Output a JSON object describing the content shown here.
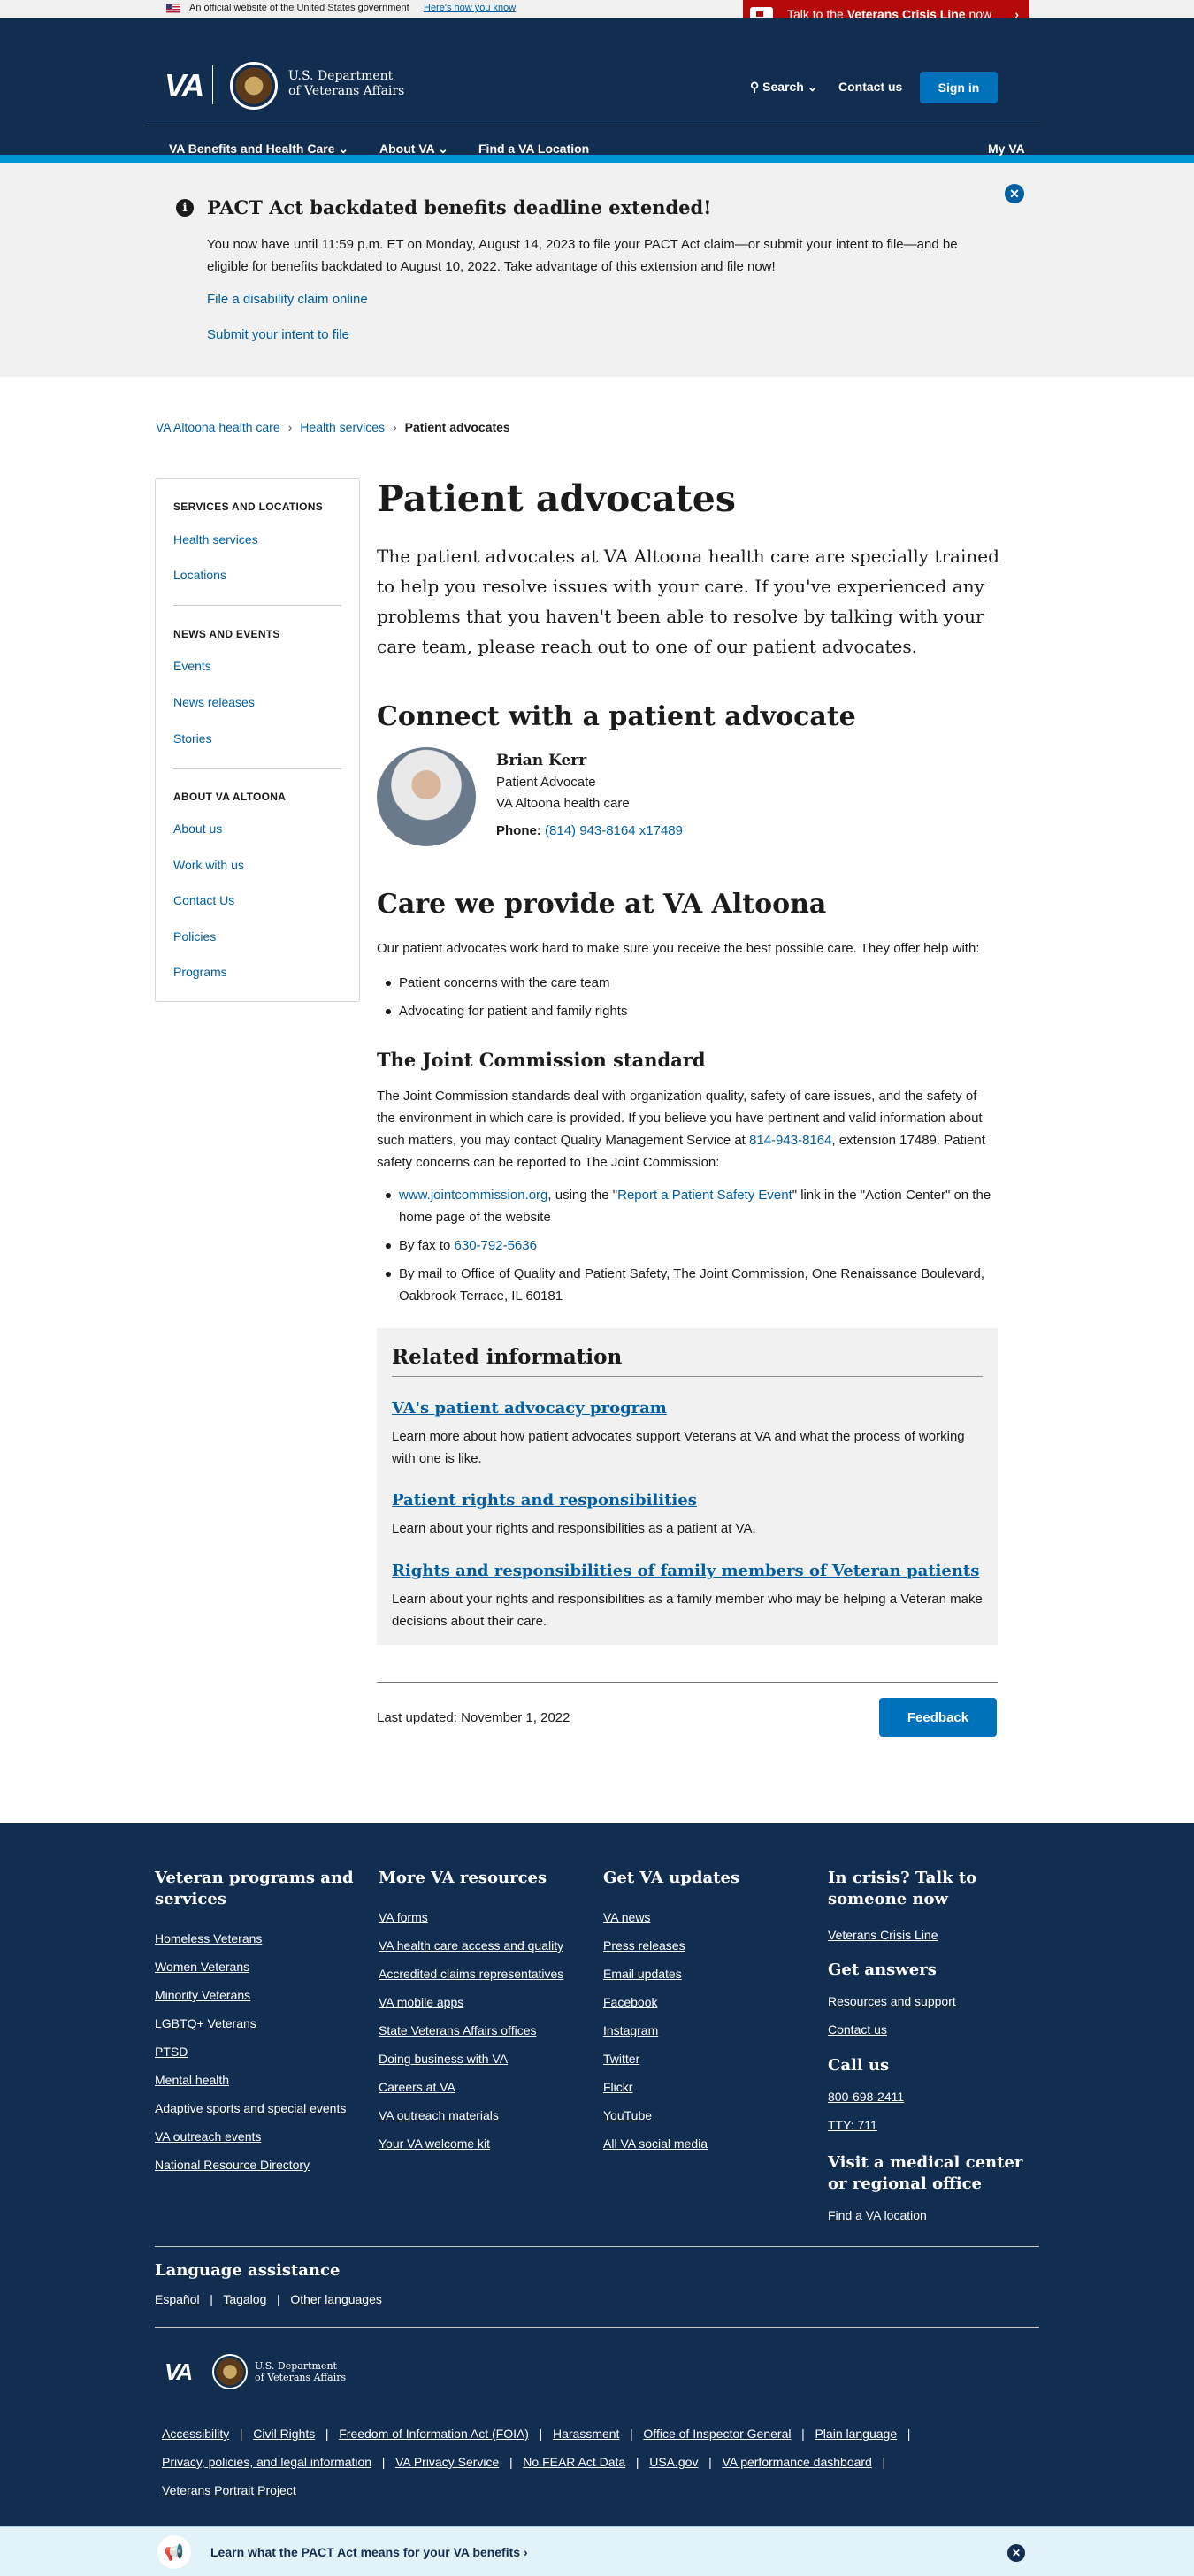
{
  "official": {
    "text": "An official website of the United States government",
    "how": "Here's how you know"
  },
  "crisis": {
    "prefix": "Talk to the",
    "bold": "Veterans Crisis Line",
    "suffix": "now"
  },
  "header": {
    "logo": "VA",
    "dept_line1": "U.S. Department",
    "dept_line2": "of Veterans Affairs",
    "search": "Search",
    "contact": "Contact us",
    "signin": "Sign in",
    "nav": [
      "VA Benefits and Health Care",
      "About VA",
      "Find a VA Location",
      "My VA"
    ]
  },
  "alert": {
    "title": "PACT Act backdated benefits deadline extended!",
    "body": "You now have until 11:59 p.m. ET on Monday, August 14, 2023 to file your PACT Act claim—or submit your intent to file—and be eligible for benefits backdated to August 10, 2022. Take advantage of this extension and file now!",
    "link1": "File a disability claim online",
    "link2": "Submit your intent to file"
  },
  "breadcrumb": [
    "VA Altoona health care",
    "Health services",
    "Patient advocates"
  ],
  "sidebar": {
    "sections": [
      {
        "title": "SERVICES AND LOCATIONS",
        "items": [
          "Health services",
          "Locations"
        ]
      },
      {
        "title": "NEWS AND EVENTS",
        "items": [
          "Events",
          "News releases",
          "Stories"
        ]
      },
      {
        "title": "ABOUT VA ALTOONA",
        "items": [
          "About us",
          "Work with us",
          "Contact Us",
          "Policies",
          "Programs"
        ]
      }
    ]
  },
  "main": {
    "title": "Patient advocates",
    "lead": "The patient advocates at VA Altoona health care are specially trained to help you resolve issues with your care. If you've experienced any problems that you haven't been able to resolve by talking with your care team, please reach out to one of our patient advocates.",
    "connect_title": "Connect with a patient advocate",
    "advocate": {
      "name": "Brian Kerr",
      "role": "Patient Advocate",
      "org": "VA Altoona health care",
      "phone_label": "Phone:",
      "phone": "(814) 943-8164 x17489"
    },
    "care_title": "Care we provide at VA Altoona",
    "care_intro": "Our patient advocates work hard to make sure you receive the best possible care. They offer help with:",
    "care_items": [
      "Patient concerns with the care team",
      "Advocating for patient and family rights"
    ],
    "joint_title": "The Joint Commission standard",
    "joint_p1": "The Joint Commission standards deal with organization quality, safety of care issues, and the safety of the environment in which care is provided. If you believe you have pertinent and valid information about such matters, you may contact Quality Management Service at",
    "joint_phone": "814-943-8164",
    "joint_p2": ", extension 17489. Patient safety concerns can be reported to The Joint Commission:",
    "joint_b1_link": "www.jointcommission.org",
    "joint_b1_mid": ", using the \"",
    "joint_b1_link2": "Report a Patient Safety Event",
    "joint_b1_end": "\" link in the \"Action Center\" on the home page of the website",
    "joint_b2_pre": "By fax to ",
    "joint_b2_link": "630-792-5636",
    "joint_b3": "By mail to Office of Quality and Patient Safety, The Joint Commission, One Renaissance Boulevard, Oakbrook Terrace, IL 60181"
  },
  "related": {
    "title": "Related information",
    "items": [
      {
        "link": "VA's patient advocacy program",
        "desc": "Learn more about how patient advocates support Veterans at VA and what the process of working with one is like."
      },
      {
        "link": "Patient rights and responsibilities",
        "desc": "Learn about your rights and responsibilities as a patient at VA."
      },
      {
        "link": "Rights and responsibilities of family members of Veteran patients",
        "desc": "Learn about your rights and responsibilities as a family member who may be helping a Veteran make decisions about their care."
      }
    ]
  },
  "updated": "Last updated: November 1, 2022",
  "feedback": "Feedback",
  "footer": {
    "col1": {
      "title": "Veteran programs and services",
      "links": [
        "Homeless Veterans",
        "Women Veterans",
        "Minority Veterans",
        "LGBTQ+ Veterans",
        "PTSD",
        "Mental health",
        "Adaptive sports and special events",
        "VA outreach events",
        "National Resource Directory"
      ]
    },
    "col2": {
      "title": "More VA resources",
      "links": [
        "VA forms",
        "VA health care access and quality",
        "Accredited claims representatives",
        "VA mobile apps",
        "State Veterans Affairs offices",
        "Doing business with VA",
        "Careers at VA",
        "VA outreach materials",
        "Your VA welcome kit"
      ]
    },
    "col3": {
      "title": "Get VA updates",
      "links": [
        "VA news",
        "Press releases",
        "Email updates",
        "Facebook",
        "Instagram",
        "Twitter",
        "Flickr",
        "YouTube",
        "All VA social media"
      ]
    },
    "col4": {
      "crisis_title": "In crisis? Talk to someone now",
      "crisis_link": "Veterans Crisis Line",
      "answers_title": "Get answers",
      "answers_links": [
        "Resources and support",
        "Contact us"
      ],
      "call_title": "Call us",
      "call_links": [
        "800-698-2411",
        "TTY: 711"
      ],
      "visit_title": "Visit a medical center or regional office",
      "visit_link": "Find a VA location"
    },
    "lang_title": "Language assistance",
    "lang_links": [
      "Español",
      "Tagalog",
      "Other languages"
    ],
    "bottom_links_row1": [
      "Accessibility",
      "Civil Rights",
      "Freedom of Information Act (FOIA)",
      "Harassment",
      "Office of Inspector General",
      "Plain language"
    ],
    "bottom_links_row2": [
      "Privacy, policies, and legal information",
      "VA Privacy Service",
      "No FEAR Act Data",
      "USA.gov",
      "VA performance dashboard"
    ],
    "bottom_links_row3": [
      "Veterans Portrait Project"
    ]
  },
  "pact_banner": "Learn what the PACT Act means for your VA benefits ›"
}
